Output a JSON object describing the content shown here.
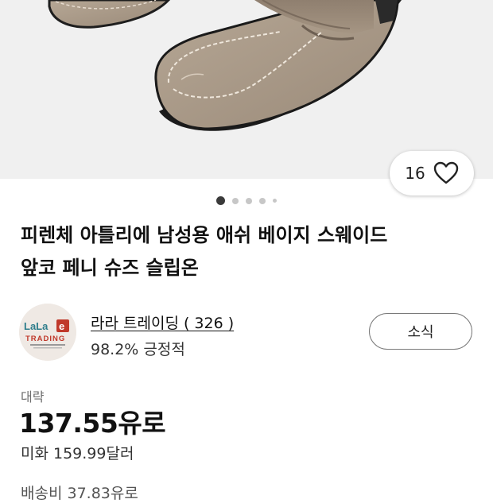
{
  "product": {
    "title_line1": "피렌체 아틀리에 남성용 애쉬 베이지 스웨이드",
    "title_line2": "앞코 페니 슈즈 슬립온",
    "image_alt": "taupe suede penny loafers",
    "gallery": {
      "total": 5,
      "current": 1
    },
    "likes": "16"
  },
  "seller": {
    "name": "라라 트레이딩 ( 326 )",
    "feedback": "98.2% 긍정적",
    "logo_text": "LaLa",
    "logo_badge": "e",
    "logo_sub": "TRADING",
    "logo_tagline": "eBay Seller · Fashion from Korea to the World",
    "follow_label": "소식"
  },
  "pricing": {
    "approx_label": "대략",
    "price": "137.55유로",
    "usd_price": "미화 159.99달러",
    "shipping": "배송비 37.83유로"
  },
  "icons": {
    "like": "heart-icon"
  },
  "colors": {
    "suede": "#a79786",
    "logo_red": "#c0392b",
    "logo_teal": "#2f7e8c"
  }
}
